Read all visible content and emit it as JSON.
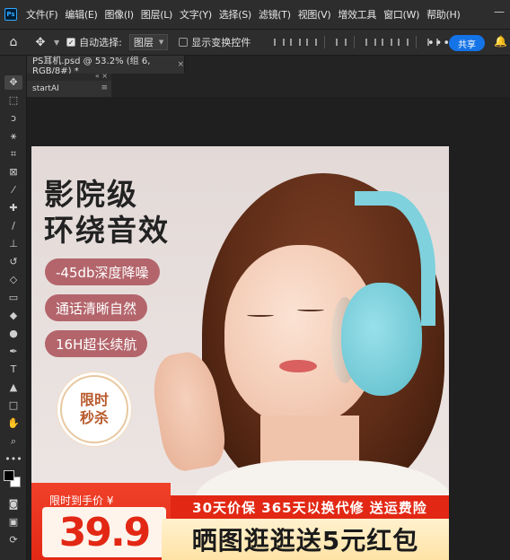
{
  "menubar": {
    "logo": "Ps",
    "items": [
      "文件(F)",
      "编辑(E)",
      "图像(I)",
      "图层(L)",
      "文字(Y)",
      "选择(S)",
      "滤镜(T)",
      "视图(V)",
      "增效工具",
      "窗口(W)",
      "帮助(H)"
    ]
  },
  "options": {
    "auto_select_label": "自动选择:",
    "auto_select_value": "图层",
    "show_transform_label": "显示变换控件",
    "more": "•••",
    "share": "共享"
  },
  "document_tab": {
    "title": "PS耳机.psd @ 53.2% (组 6, RGB/8#) *",
    "close": "×"
  },
  "panel": {
    "collapse": "«",
    "close": "×",
    "title": "startAI",
    "menu": "≡"
  },
  "artboard": {
    "headline_line1": "影院级",
    "headline_line2": "环绕音效",
    "pills": [
      "-45db深度降噪",
      "通话清晰自然",
      "16H超长续航"
    ],
    "badge_line1": "限时",
    "badge_line2": "秒杀",
    "promo_label": "限时到手价 ¥",
    "price": "39.9",
    "promo_bar": "30天价保 365天以换代修 送运费险",
    "promo_yellow": "晒图逛逛送5元红包"
  },
  "icons": {
    "home": "⌂",
    "move": "✥",
    "bell": "🔔"
  },
  "colors": {
    "share_button": "#1473e6",
    "pill": "#b3656b",
    "promo_red": "#e22814",
    "promo_yellow": "#ffe3a6"
  }
}
